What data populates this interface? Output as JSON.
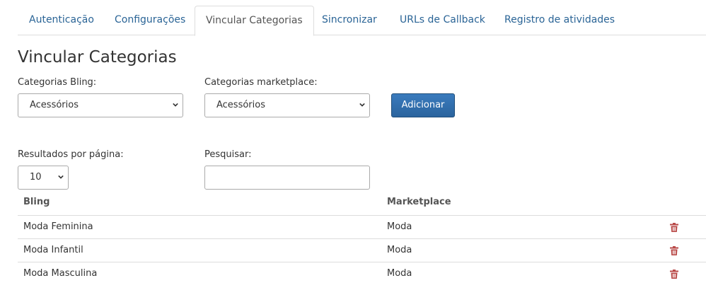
{
  "tabs": [
    {
      "label": "Autenticação"
    },
    {
      "label": "Configurações"
    },
    {
      "label": "Vincular Categorias"
    },
    {
      "label": "Sincronizar"
    },
    {
      "label": "URLs de Callback"
    },
    {
      "label": "Registro de atividades"
    }
  ],
  "active_tab": "Vincular Categorias",
  "page_title": "Vincular Categorias",
  "form": {
    "bling_label": "Categorias Bling:",
    "bling_selected": "Acessórios",
    "marketplace_label": "Categorias marketplace:",
    "marketplace_selected": "Acessórios",
    "add_button": "Adicionar"
  },
  "table_controls": {
    "per_page_label": "Resultados por página:",
    "per_page_value": "10",
    "search_label": "Pesquisar:",
    "search_value": ""
  },
  "table": {
    "headers": {
      "bling": "Bling",
      "marketplace": "Marketplace"
    },
    "rows": [
      {
        "bling": "Moda Feminina",
        "marketplace": "Moda"
      },
      {
        "bling": "Moda Infantil",
        "marketplace": "Moda"
      },
      {
        "bling": "Moda Masculina",
        "marketplace": "Moda"
      }
    ]
  },
  "colors": {
    "link": "#2a6496",
    "primary_button": "#337ab7",
    "delete_icon": "#b94a48",
    "border": "#dddddd"
  },
  "icons": [
    "chevron-down-icon",
    "trash-icon"
  ]
}
